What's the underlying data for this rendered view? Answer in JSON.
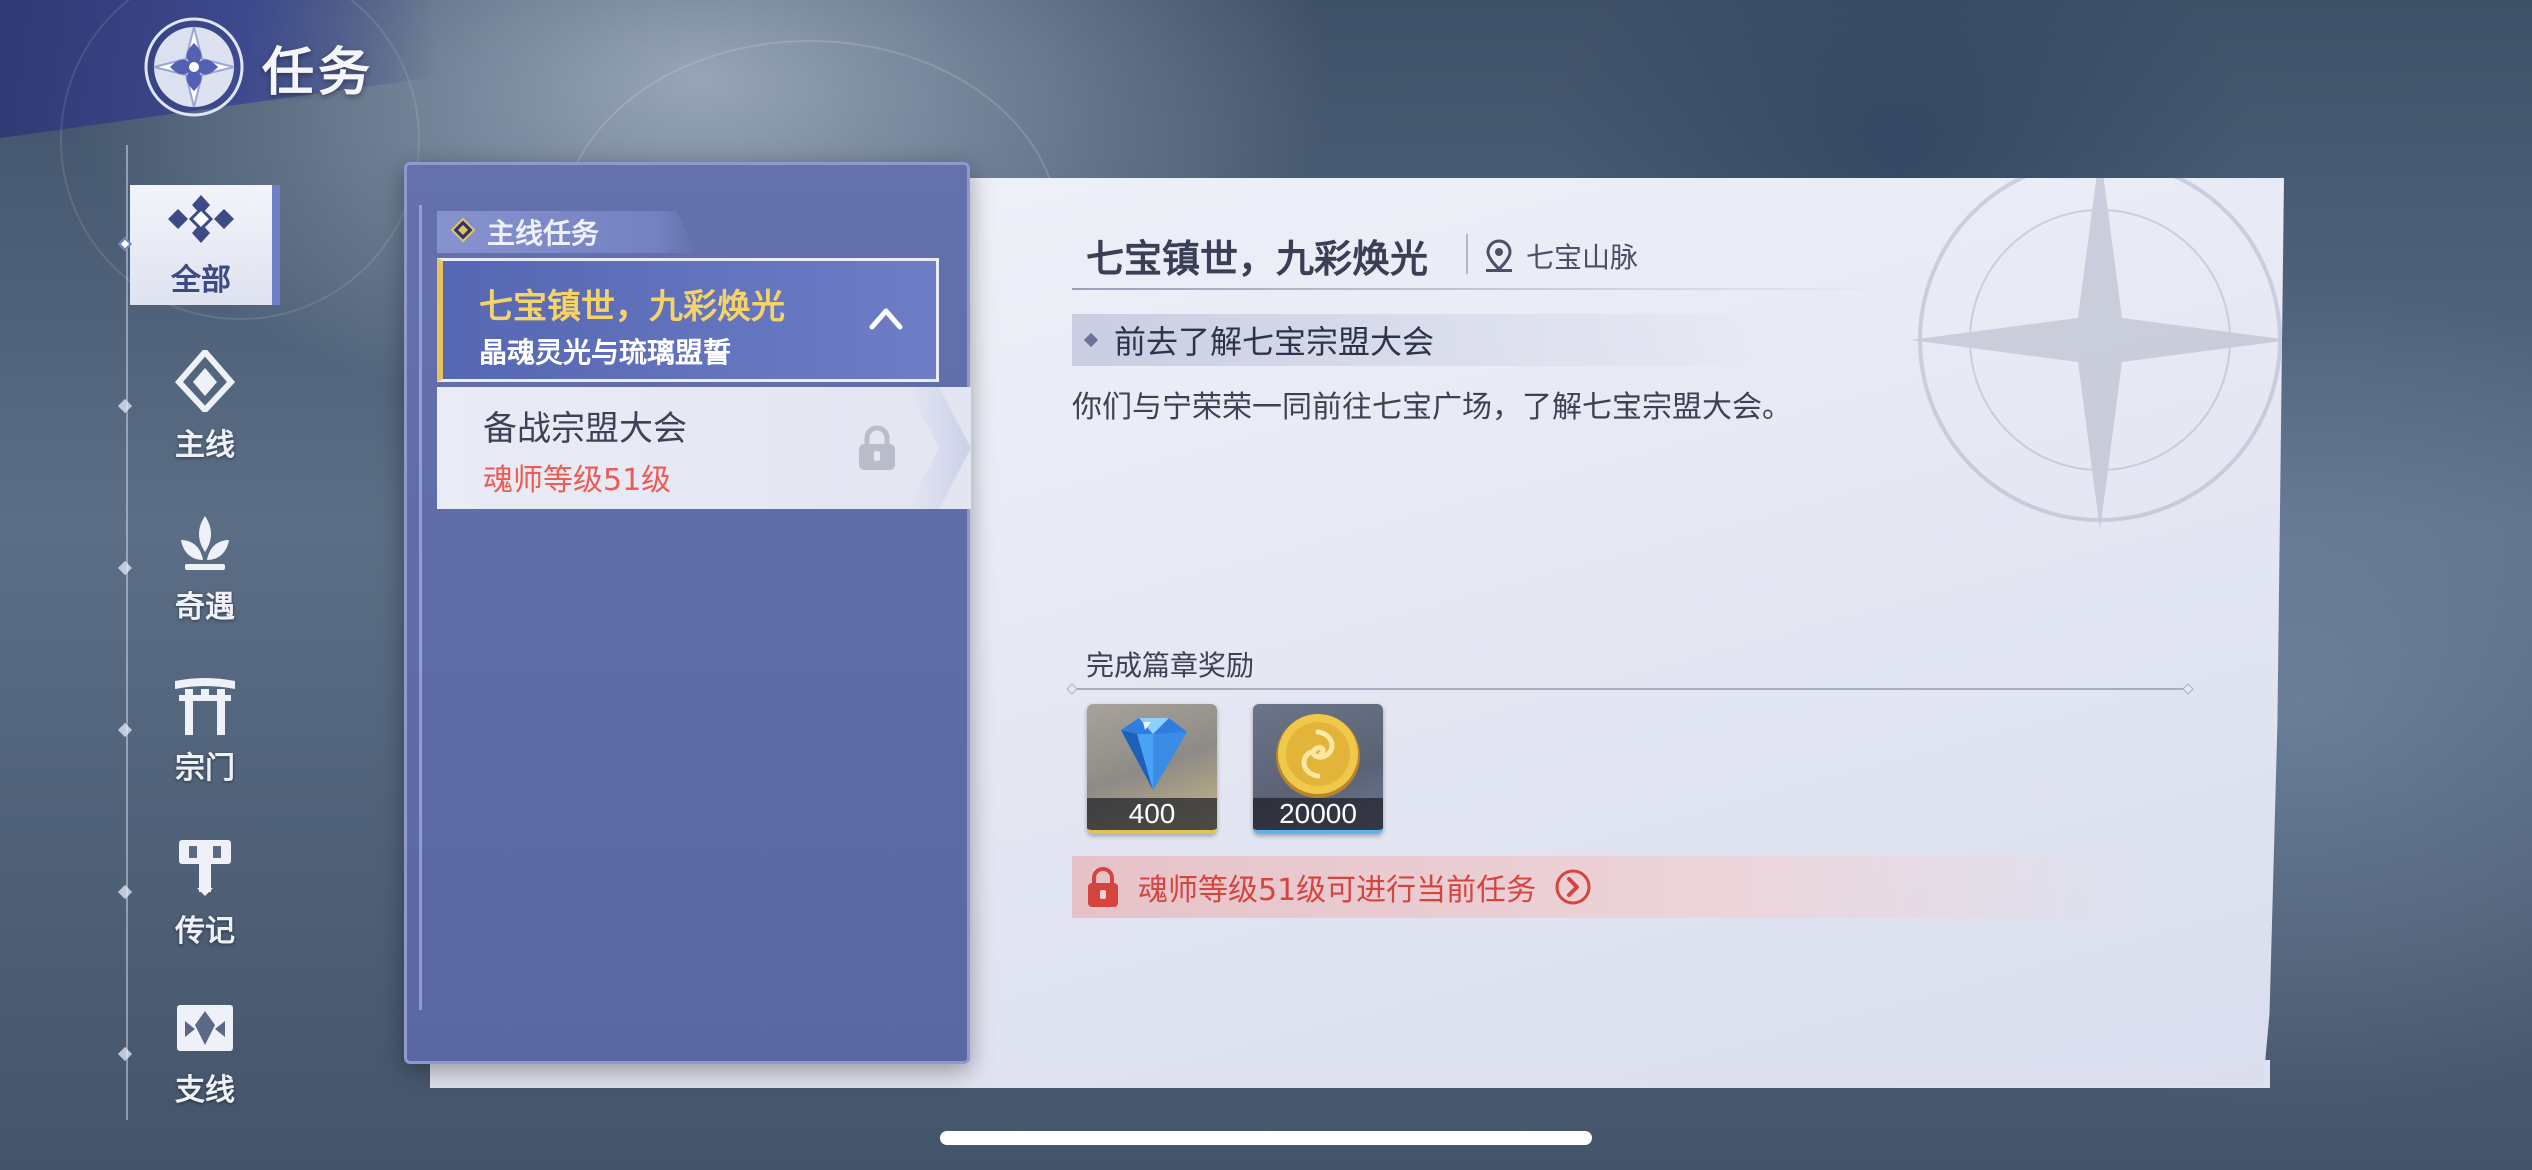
{
  "header": {
    "title": "任务",
    "logo_icon": "compass-flower-icon"
  },
  "nav": {
    "items": [
      {
        "label": "全部",
        "icon": "diamond-cluster-icon",
        "active": true
      },
      {
        "label": "主线",
        "icon": "main-quest-icon",
        "active": false
      },
      {
        "label": "奇遇",
        "icon": "sprout-icon",
        "active": false
      },
      {
        "label": "宗门",
        "icon": "gate-icon",
        "active": false
      },
      {
        "label": "传记",
        "icon": "hammer-icon",
        "active": false
      },
      {
        "label": "支线",
        "icon": "side-quest-icon",
        "active": false
      }
    ]
  },
  "quest_list": {
    "section_label": "主线任务",
    "active_quest": {
      "title": "七宝镇世，九彩焕光",
      "subtitle": "晶魂灵光与琉璃盟誓"
    },
    "locked_quest": {
      "title": "备战宗盟大会",
      "requirement": "魂师等级51级"
    }
  },
  "detail": {
    "title": "七宝镇世，九彩焕光",
    "location": "七宝山脉",
    "objective": "前去了解七宝宗盟大会",
    "description": "你们与宁荣荣一同前往七宝广场，了解七宝宗盟大会。",
    "reward_title": "完成篇章奖励",
    "rewards": [
      {
        "name": "blue-gem-icon",
        "count": "400"
      },
      {
        "name": "gold-coin-icon",
        "count": "20000"
      }
    ],
    "lock_message": "魂师等级51级可进行当前任务"
  },
  "colors": {
    "accent_gold": "#f4d36b",
    "locked_red": "#ec5b54",
    "panel_blue": "#5a67a3",
    "nav_active": "#6f7fc6"
  }
}
